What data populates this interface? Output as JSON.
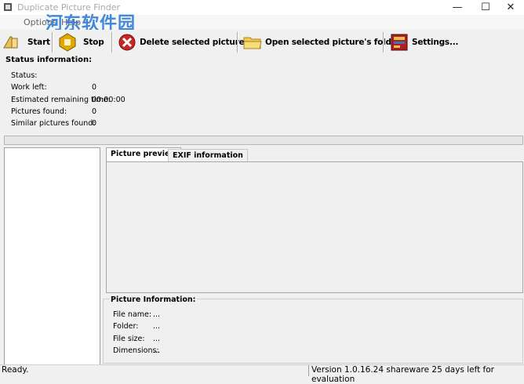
{
  "window": {
    "title": "Duplicate Picture Finder",
    "minimize_glyph": "—",
    "maximize_glyph": "☐",
    "close_glyph": "✕"
  },
  "watermark": {
    "text": "河东软件园",
    "url_fragment": "pc03"
  },
  "menu": {
    "items": [
      "Options",
      "Help"
    ]
  },
  "toolbar": {
    "start_label": "Start",
    "stop_label": "Stop",
    "delete_label": "Delete selected pictures...",
    "open_folder_label": "Open selected picture's folder",
    "settings_label": "Settings..."
  },
  "status_info": {
    "heading": "Status information:",
    "rows": [
      {
        "label": "Status:",
        "value": ""
      },
      {
        "label": "Work left:",
        "value": "0"
      },
      {
        "label": "Estimated remaining time:",
        "value": "00:00:00"
      },
      {
        "label": "Pictures found:",
        "value": "0"
      },
      {
        "label": "Similar pictures found:",
        "value": "0"
      }
    ],
    "progress_fraction": 0
  },
  "tabs": [
    {
      "label": "Picture preview",
      "active": true
    },
    {
      "label": "EXIF information",
      "active": false
    }
  ],
  "picture_info": {
    "heading": "Picture Information:",
    "rows": [
      {
        "label": "File name:",
        "value": "..."
      },
      {
        "label": "Folder:",
        "value": "..."
      },
      {
        "label": "File size:",
        "value": "..."
      },
      {
        "label": "Dimensions:",
        "value": "..."
      }
    ]
  },
  "statusbar": {
    "left": "Ready.",
    "right": "Version 1.0.16.24 shareware 25 days left for evaluation"
  },
  "colors": {
    "watermark": "#2e7dd6",
    "folder": "#f2c94c",
    "stop": "#e0a800",
    "delete": "#c62828"
  }
}
